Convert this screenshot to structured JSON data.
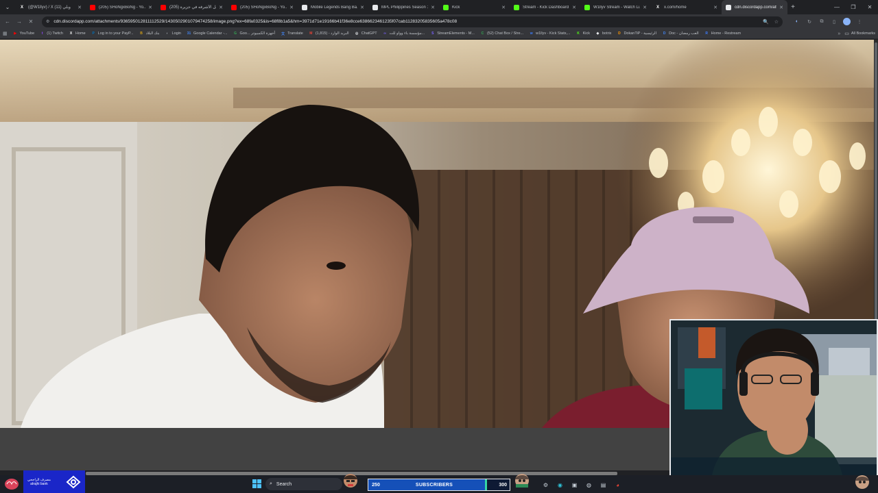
{
  "tabs": [
    {
      "title": "(@W1llyv) / X (11) وبلي",
      "icon": "x-icon",
      "color": "#ffffff"
    },
    {
      "title": "(205) SHoNgxBoNg - Yo...",
      "icon": "youtube-icon",
      "color": "#ff0000"
    },
    {
      "title": "(205) كل الأشرفه في جزيرة",
      "icon": "youtube-icon",
      "color": "#ff0000"
    },
    {
      "title": "(205) SHoNgxBoNg - Yo...",
      "icon": "youtube-icon",
      "color": "#ff0000"
    },
    {
      "title": "Mobile Legends Bang Ba...",
      "icon": "mlbb-icon",
      "color": "#e8eaed"
    },
    {
      "title": "MPL Philippines Season 1...",
      "icon": "mpl-icon",
      "color": "#e8eaed"
    },
    {
      "title": "Kick",
      "icon": "kick-icon",
      "color": "#53fc18"
    },
    {
      "title": "Stream - Kick Dashboard",
      "icon": "kick-icon",
      "color": "#53fc18"
    },
    {
      "title": "W1llyv Stream - Watch Li...",
      "icon": "kick-icon",
      "color": "#53fc18"
    },
    {
      "title": "x.com/home",
      "icon": "x-icon",
      "color": "#ffffff"
    },
    {
      "title": "cdn.discordapp.com/atta...",
      "icon": "discord-icon",
      "color": "#e8eaed",
      "active": true
    }
  ],
  "address_bar": {
    "url": "cdn.discordapp.com/attachments/936595012811112529/1430502901079474258/image.png?ex=68fa0325&is=68f8b1a5&hm=3971d71e19166b41f36e8cce6386623461235f07cab11283205835605a478c08"
  },
  "bookmarks": [
    {
      "label": "YouTube",
      "color": "#ff0000",
      "glyph": "▶"
    },
    {
      "label": "(1) Twitch",
      "color": "#9146ff",
      "glyph": "t"
    },
    {
      "label": "Home",
      "color": "#ffffff",
      "glyph": "X"
    },
    {
      "label": "Log in to your PayP...",
      "color": "#0070ba",
      "glyph": "P"
    },
    {
      "label": "بنك البلاد",
      "color": "#d4a017",
      "glyph": "B"
    },
    {
      "label": "Login",
      "color": "#9aa0a6",
      "glyph": "◐"
    },
    {
      "label": "Google Calendar -...",
      "color": "#4285f4",
      "glyph": "31"
    },
    {
      "label": "Goo... أجهزة الكمبيوتر",
      "color": "#34a853",
      "glyph": "G"
    },
    {
      "label": "Translate",
      "color": "#4285f4",
      "glyph": "文"
    },
    {
      "label": "البريد الوارد - (1,815)",
      "color": "#ea4335",
      "glyph": "M"
    },
    {
      "label": "ChatGPT",
      "color": "#e8eaed",
      "glyph": "◎"
    },
    {
      "label": "مؤسسة باء وواو للت...",
      "color": "#7b61ff",
      "glyph": "∞"
    },
    {
      "label": "StreamElements - M...",
      "color": "#7b61ff",
      "glyph": "S"
    },
    {
      "label": "(52) Chat Box / Stre...",
      "color": "#34a853",
      "glyph": "C"
    },
    {
      "label": "w1llyv - Kick Stats,...",
      "color": "#3d7eff",
      "glyph": "w"
    },
    {
      "label": "Kick",
      "color": "#53fc18",
      "glyph": "K"
    },
    {
      "label": "botrix",
      "color": "#e8eaed",
      "glyph": "◆"
    },
    {
      "label": "DokanTiP - الرئيسية",
      "color": "#ff9800",
      "glyph": "D"
    },
    {
      "label": "Doc - العب رمضان",
      "color": "#4285f4",
      "glyph": "D"
    },
    {
      "label": "Home - Restream",
      "color": "#3d7eff",
      "glyph": "R"
    }
  ],
  "all_bookmarks_label": "All Bookmarks",
  "taskbar": {
    "bank_name_ar": "مصرف الراجحي",
    "bank_name_en": "alrajhi bank",
    "search_label": "Search",
    "subs_left": "250",
    "subs_label": "SUBSCRIBERS",
    "subs_right": "300",
    "subs_progress": 0.0
  }
}
